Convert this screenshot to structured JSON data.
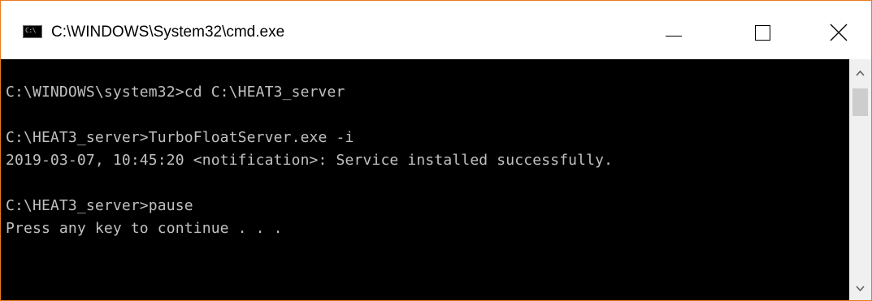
{
  "window": {
    "title": "C:\\WINDOWS\\System32\\cmd.exe",
    "icon_name": "cmd-icon",
    "icon_text": "C:\\",
    "border_color": "#e87b1e"
  },
  "controls": {
    "minimize_icon": "minimize-icon",
    "maximize_icon": "maximize-icon",
    "close_icon": "close-icon"
  },
  "console": {
    "background": "#000000",
    "foreground": "#c0c0c0",
    "lines": [
      "C:\\WINDOWS\\system32>cd C:\\HEAT3_server",
      "C:\\HEAT3_server>TurboFloatServer.exe -i",
      "2019-03-07, 10:45:20 <notification>: Service installed successfully.",
      "C:\\HEAT3_server>pause",
      "Press any key to continue . . ."
    ]
  },
  "scrollbar": {
    "up_icon": "scroll-up-arrow-icon",
    "down_icon": "scroll-down-arrow-icon"
  }
}
